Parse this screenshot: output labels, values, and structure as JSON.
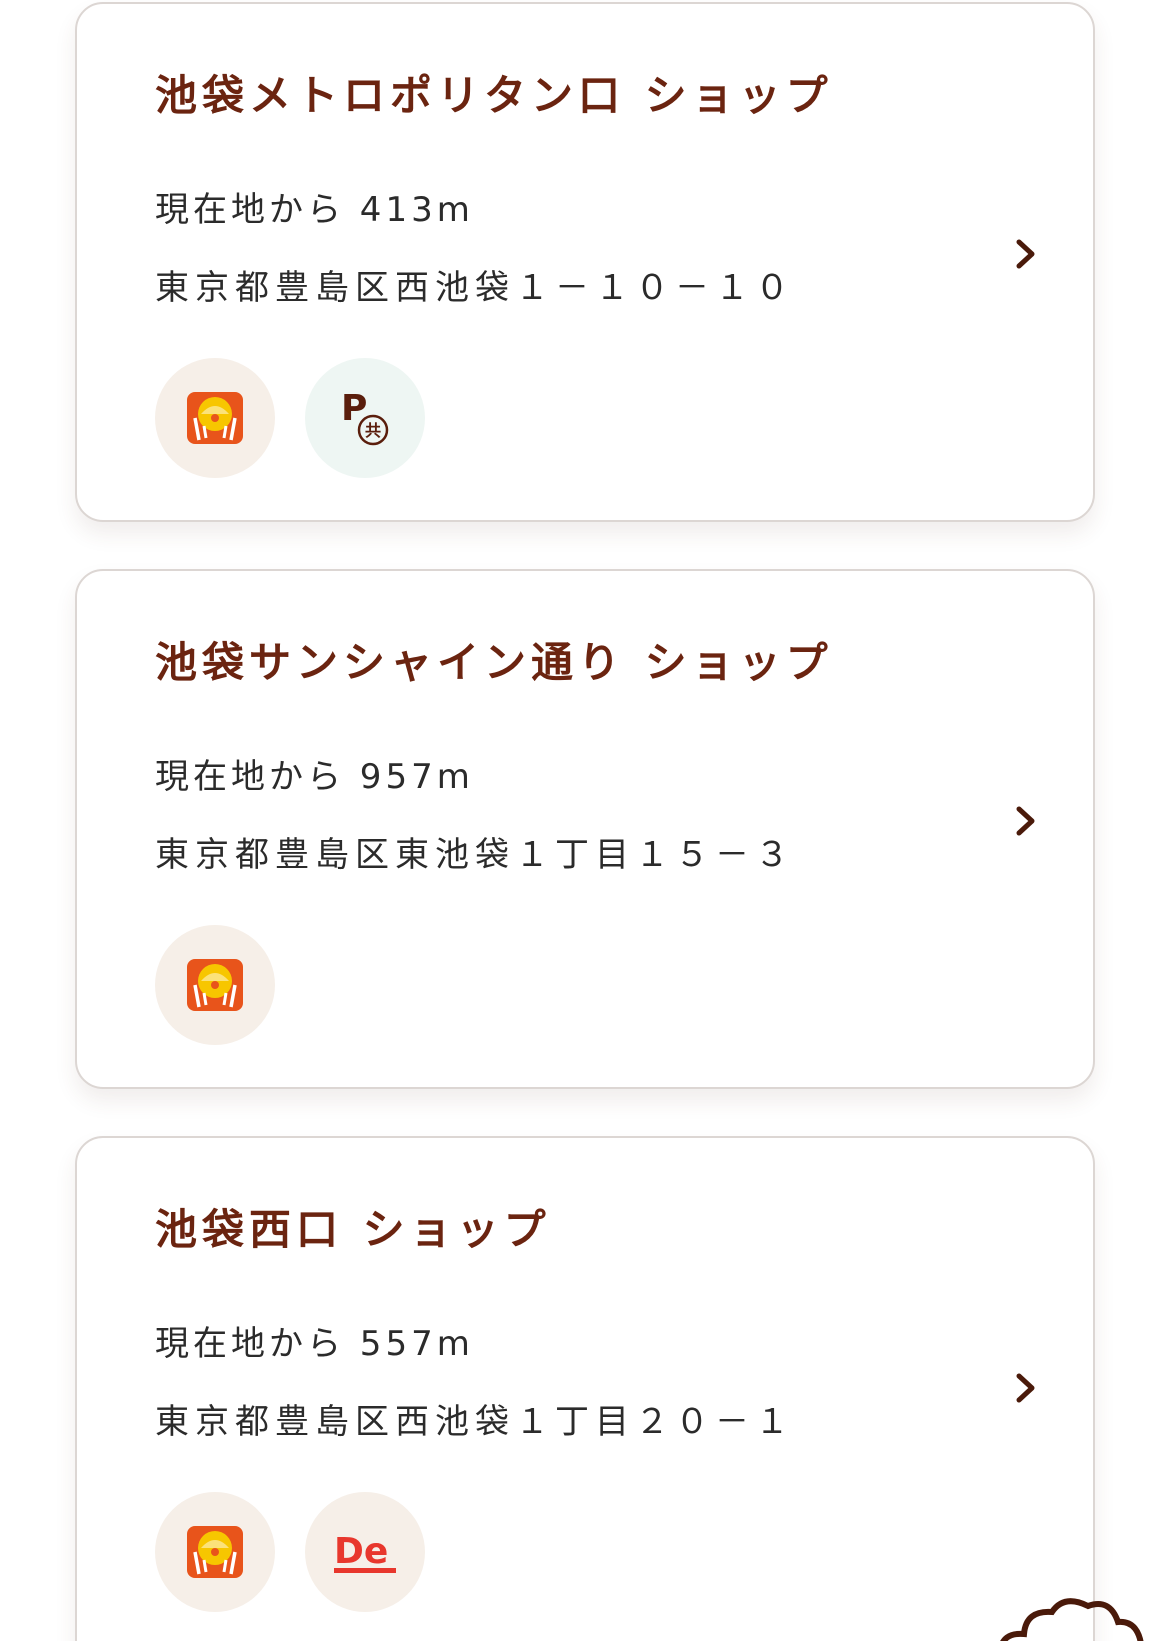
{
  "shops": [
    {
      "name": "池袋メトロポリタン口 ショップ",
      "distance": "現在地から 413m",
      "address": "東京都豊島区西池袋１－１０－１０",
      "badges": [
        "mos-icon",
        "shared-parking-icon"
      ]
    },
    {
      "name": "池袋サンシャイン通り ショップ",
      "distance": "現在地から 957m",
      "address": "東京都豊島区東池袋１丁目１５－３",
      "badges": [
        "mos-icon"
      ]
    },
    {
      "name": "池袋西口 ショップ",
      "distance": "現在地から 557m",
      "address": "東京都豊島区西池袋１丁目２０－１",
      "badges": [
        "mos-icon",
        "delivery-icon"
      ]
    }
  ],
  "icons": {
    "chevron": "chevron-right-icon",
    "parking_letter": "P",
    "parking_mark": "共",
    "delivery_text": "De"
  },
  "colors": {
    "title": "#6b2410",
    "text": "#2b2b2b",
    "card_border": "#dcd6d3",
    "badge_bg": "#f6efe8",
    "parking_bg": "#eef6f3",
    "mos_orange": "#e8541b",
    "mos_yellow": "#f7c600",
    "delivery_red": "#e8372d"
  }
}
